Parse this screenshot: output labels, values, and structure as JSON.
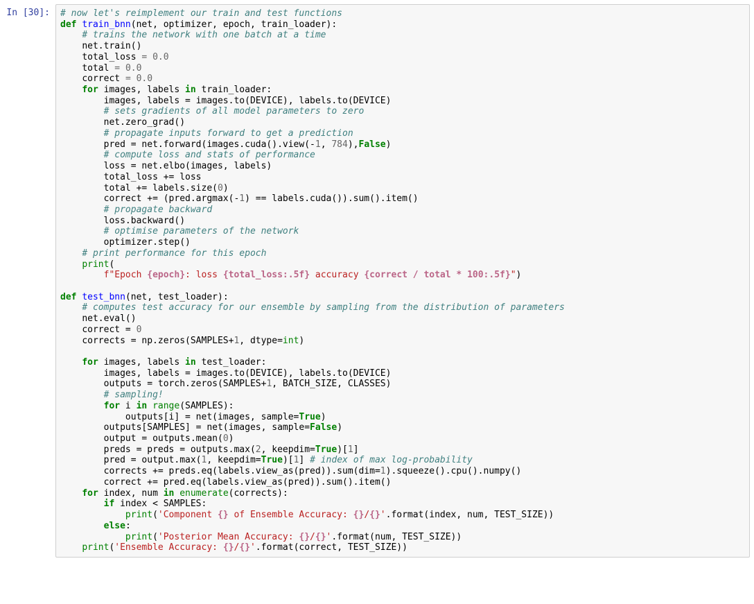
{
  "prompt": "In [30]:",
  "code": {
    "l01": {
      "c": "# now let's reimplement our train and test functions"
    },
    "l02": {
      "k": "def",
      "nf": "train_bnn",
      "args": "(net, optimizer, epoch, train_loader):"
    },
    "l03": {
      "c": "# trains the network with one batch at a time"
    },
    "l04": "net.train()",
    "l05": "total_loss = 0.0",
    "l06": "total = 0.0",
    "l07": "correct = 0.0",
    "l08": {
      "k1": "for",
      "mid": " images, labels ",
      "k2": "in",
      "tail": " train_loader:"
    },
    "l09": "images, labels = images.to(DEVICE), labels.to(DEVICE)",
    "l10": {
      "c": "# sets gradients of all model parameters to zero"
    },
    "l11": "net.zero_grad()",
    "l12": {
      "c": "# propagate inputs forward to get a prediction"
    },
    "l13a": "pred = net.forward(images.cuda().view(-",
    "l13n": "1",
    "l13b": ", ",
    "l13m": "784",
    "l13c": "),",
    "l13k": "False",
    "l13d": ")",
    "l14": {
      "c": "# compute loss and stats of performance"
    },
    "l15": "loss = net.elbo(images, labels)",
    "l16": "total_loss += loss",
    "l17a": "total += labels.size(",
    "l17n": "0",
    "l17b": ")",
    "l18a": "correct += (pred.argmax(-",
    "l18n": "1",
    "l18b": ") == labels.cuda()).sum().item()",
    "l19": {
      "c": "# propagate backward"
    },
    "l20": "loss.backward()",
    "l21": {
      "c": "# optimise parameters of the network"
    },
    "l22": "optimizer.step()",
    "l23": {
      "c": "# print performance for this epoch"
    },
    "l24": "print",
    "l25p": "f",
    "l25a": "\"Epoch ",
    "l25b": "{epoch}",
    "l25c": ": loss ",
    "l25d": "{total_loss:.5f}",
    "l25e": " accuracy ",
    "l25f": "{correct / total * 100:.5f}",
    "l25g": "\"",
    "l27": {
      "k": "def",
      "nf": "test_bnn",
      "args": "(net, test_loader):"
    },
    "l28": {
      "c": "# computes test accuracy for our ensemble by sampling from the distribution of parameters"
    },
    "l29": "net.eval()",
    "l30a": "correct = ",
    "l30n": "0",
    "l31a": "corrects = np.zeros(SAMPLES+",
    "l31n": "1",
    "l31b": ", dtype=",
    "l31k": "int",
    "l31c": ")",
    "l33": {
      "k1": "for",
      "mid": " images, labels ",
      "k2": "in",
      "tail": " test_loader:"
    },
    "l34": "images, labels = images.to(DEVICE), labels.to(DEVICE)",
    "l35a": "outputs = torch.zeros(SAMPLES+",
    "l35n": "1",
    "l35b": ", BATCH_SIZE, CLASSES)",
    "l36": {
      "c": "# sampling!"
    },
    "l37": {
      "k1": "for",
      "mid": " i ",
      "k2": "in",
      "nb": " range",
      "tail": "(SAMPLES):"
    },
    "l38a": "outputs[i] = net(images, sample=",
    "l38k": "True",
    "l38b": ")",
    "l39a": "outputs[SAMPLES] = net(images, sample=",
    "l39k": "False",
    "l39b": ")",
    "l40a": "output = outputs.mean(",
    "l40n": "0",
    "l40b": ")",
    "l41a": "preds = preds = outputs.max(",
    "l41n": "2",
    "l41b": ", keepdim=",
    "l41k": "True",
    "l41c": ")[",
    "l41m": "1",
    "l41d": "]",
    "l42a": "pred = output.max(",
    "l42n": "1",
    "l42b": ", keepdim=",
    "l42k": "True",
    "l42c": ")[",
    "l42m": "1",
    "l42d": "] ",
    "l42cm": "# index of max log-probability",
    "l43a": "corrects += preds.eq(labels.view_as(pred)).sum(dim=",
    "l43n": "1",
    "l43b": ").squeeze().cpu().numpy()",
    "l44": "correct += pred.eq(labels.view_as(pred)).sum().item()",
    "l45": {
      "k1": "for",
      "mid": " index, num ",
      "k2": "in",
      "nb": " enumerate",
      "tail": "(corrects):"
    },
    "l46": {
      "k": "if",
      "tail": " index < SAMPLES:"
    },
    "l47a": "print",
    "l47s": "'Component ",
    "l47b": "{}",
    "l47c": " of Ensemble Accuracy: ",
    "l47d": "{}",
    "l47e": "/",
    "l47f": "{}",
    "l47g": "'",
    "l47t": ".format(index, num, TEST_SIZE))",
    "l48": {
      "k": "else",
      "tail": ":"
    },
    "l49a": "print",
    "l49s": "'Posterior Mean Accuracy: ",
    "l49b": "{}",
    "l49c": "/",
    "l49d": "{}",
    "l49e": "'",
    "l49t": ".format(num, TEST_SIZE))",
    "l50a": "print",
    "l50s": "'Ensemble Accuracy: ",
    "l50b": "{}",
    "l50c": "/",
    "l50d": "{}",
    "l50e": "'",
    "l50t": ".format(correct, TEST_SIZE))"
  }
}
